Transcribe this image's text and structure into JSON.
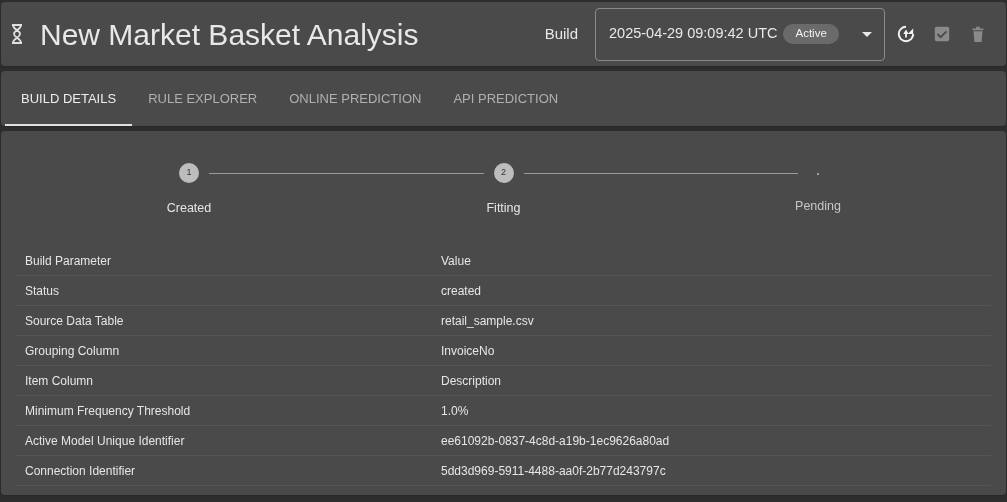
{
  "header": {
    "title": "New Market Basket Analysis",
    "build_label": "Build",
    "build_select": {
      "value": "2025-04-29 09:09:42 UTC",
      "badge": "Active"
    },
    "actions": [
      {
        "kind": "refresh",
        "disabled": false
      },
      {
        "kind": "approve",
        "disabled": true
      },
      {
        "kind": "delete",
        "disabled": true
      }
    ]
  },
  "tabs": [
    {
      "label": "BUILD DETAILS",
      "selected": true
    },
    {
      "label": "RULE EXPLORER",
      "selected": false
    },
    {
      "label": "ONLINE PREDICTION",
      "selected": false
    },
    {
      "label": "API PREDICTION",
      "selected": false
    }
  ],
  "stepper": [
    {
      "number": "1",
      "label": "Created",
      "completed": true
    },
    {
      "number": "2",
      "label": "Fitting",
      "completed": true
    },
    {
      "label": "Pending",
      "completed": false
    }
  ],
  "table": {
    "columns": [
      "Build Parameter",
      "Value"
    ],
    "rows": [
      [
        "Status",
        "created"
      ],
      [
        "Source Data Table",
        "retail_sample.csv"
      ],
      [
        "Grouping Column",
        "InvoiceNo"
      ],
      [
        "Item Column",
        "Description"
      ],
      [
        "Minimum Frequency Threshold",
        "1.0%"
      ],
      [
        "Active Model Unique Identifier",
        "ee61092b-0837-4c8d-a19b-1ec9626a80ad"
      ],
      [
        "Connection Identifier",
        "5dd3d969-5911-4488-aa0f-2b77d243797c"
      ]
    ]
  }
}
